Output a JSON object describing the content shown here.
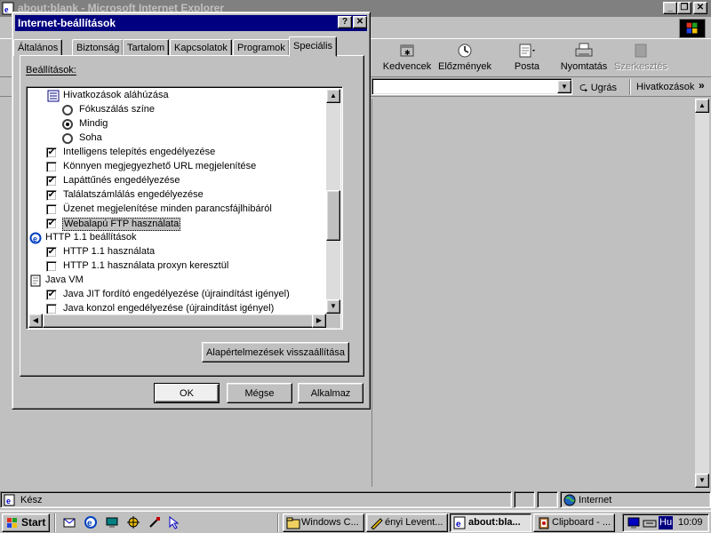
{
  "ie_window": {
    "title": "about:blank - Microsoft Internet Explorer",
    "toolbar": [
      {
        "label": "Kedvencek",
        "icon": "favorites-icon",
        "disabled": false
      },
      {
        "label": "Előzmények",
        "icon": "history-icon",
        "disabled": false
      },
      {
        "label": "Posta",
        "icon": "mail-icon",
        "disabled": false
      },
      {
        "label": "Nyomtatás",
        "icon": "print-icon",
        "disabled": false
      },
      {
        "label": "Szerkesztés",
        "icon": "edit-icon",
        "disabled": true
      }
    ],
    "address": {
      "go_label": "Ugrás",
      "links_label": "Hivatkozások",
      "more_label": "»"
    },
    "status": {
      "text": "Kész",
      "zone": "Internet"
    }
  },
  "dialog": {
    "title": "Internet-beállítások",
    "help_label": "?",
    "close_label": "✕",
    "tabs": [
      {
        "label": "Általános",
        "active": false
      },
      {
        "label": "Biztonság",
        "active": false
      },
      {
        "label": "Tartalom",
        "active": false
      },
      {
        "label": "Kapcsolatok",
        "active": false
      },
      {
        "label": "Programok",
        "active": false
      },
      {
        "label": "Speciális",
        "active": true
      }
    ],
    "settings_label": "Beállítások:",
    "settings": [
      {
        "kind": "group",
        "text": "Hivatkozások aláhúzása",
        "icon": "settings-page-icon",
        "indent": 0
      },
      {
        "kind": "radio",
        "text": "Fókuszálás színe",
        "checked": false,
        "indent": 1
      },
      {
        "kind": "radio",
        "text": "Mindig",
        "checked": true,
        "indent": 1
      },
      {
        "kind": "radio",
        "text": "Soha",
        "checked": false,
        "indent": 1
      },
      {
        "kind": "check",
        "text": "Intelligens telepítés engedélyezése",
        "checked": true,
        "indent": 0
      },
      {
        "kind": "check",
        "text": "Könnyen megjegyezhető URL megjelenítése",
        "checked": false,
        "indent": 0
      },
      {
        "kind": "check",
        "text": "Lapáttűnés engedélyezése",
        "checked": true,
        "indent": 0
      },
      {
        "kind": "check",
        "text": "Találatszámlálás engedélyezése",
        "checked": true,
        "indent": 0
      },
      {
        "kind": "check",
        "text": "Üzenet megjelenítése minden parancsfájlhibáról",
        "checked": false,
        "indent": 0
      },
      {
        "kind": "check",
        "text": "Webalapú FTP használata",
        "checked": true,
        "indent": 0,
        "selected": true
      },
      {
        "kind": "group",
        "text": "HTTP 1.1 beállítások",
        "icon": "ie-globe-icon",
        "indent": -1
      },
      {
        "kind": "check",
        "text": "HTTP 1.1 használata",
        "checked": true,
        "indent": 0
      },
      {
        "kind": "check",
        "text": "HTTP 1.1 használata proxyn keresztül",
        "checked": false,
        "indent": 0
      },
      {
        "kind": "group",
        "text": "Java VM",
        "icon": "java-document-icon",
        "indent": -1
      },
      {
        "kind": "check",
        "text": "Java JIT fordító engedélyezése (újraindítást igényel)",
        "checked": true,
        "indent": 0
      },
      {
        "kind": "check",
        "text": "Java konzol engedélyezése (újraindítást igényel)",
        "checked": false,
        "indent": 0
      }
    ],
    "restore_button": "Alapértelmezések visszaállítása",
    "ok_button": "OK",
    "cancel_button": "Mégse",
    "apply_button": "Alkalmaz"
  },
  "taskbar": {
    "start_label": "Start",
    "tasks": [
      {
        "label": "Windows C...",
        "icon": "folder-icon",
        "pressed": false
      },
      {
        "label": "ényi Levent...",
        "icon": "pen-icon",
        "pressed": false
      },
      {
        "label": "about:bla...",
        "icon": "ie-globe-icon",
        "pressed": true
      },
      {
        "label": "Clipboard - ...",
        "icon": "clipboard-icon",
        "pressed": false
      }
    ],
    "lang": "Hu",
    "clock": "10:09"
  },
  "colors": {
    "desktop": "#008080",
    "title_active": "#000080",
    "title_inactive": "#808080",
    "face": "#c0c0c0"
  }
}
